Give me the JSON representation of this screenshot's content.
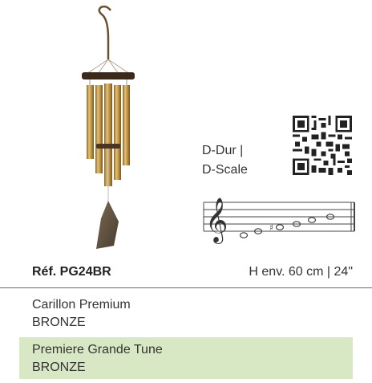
{
  "scale": {
    "line1": "D-Dur |",
    "line2": "D-Scale"
  },
  "reference": {
    "code": "Réf. PG24BR",
    "size": "H env. 60 cm | 24\""
  },
  "variants": [
    {
      "name": "Carillon Premium",
      "finish": "BRONZE",
      "highlighted": false
    },
    {
      "name": "Premiere Grande Tune",
      "finish": "BRONZE",
      "highlighted": true
    }
  ],
  "colors": {
    "highlight": "#d8e8c4",
    "tube": "#c39a4a",
    "wood": "#3b2a1c",
    "sail": "#6b5a45"
  }
}
